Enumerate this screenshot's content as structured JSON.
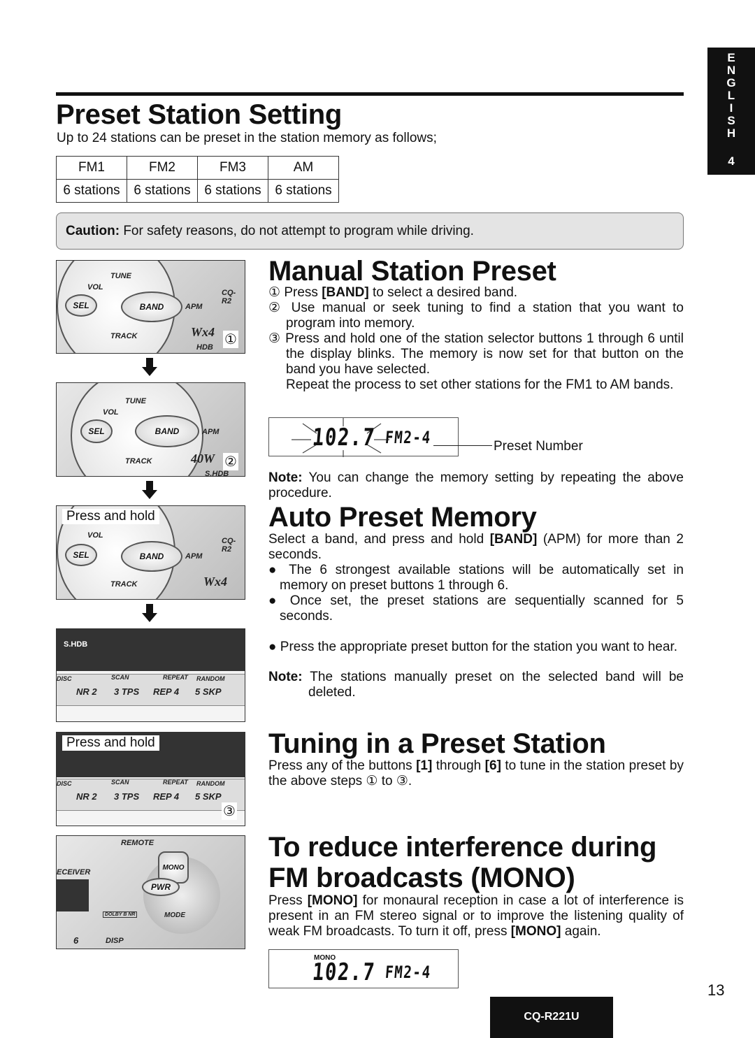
{
  "side_tab": {
    "letters": [
      "E",
      "N",
      "G",
      "L",
      "I",
      "S",
      "H"
    ],
    "number": "4"
  },
  "preset_setting": {
    "title": "Preset Station Setting",
    "intro": "Up to 24 stations can be preset in the station memory as follows;",
    "table": {
      "headers": [
        "FM1",
        "FM2",
        "FM3",
        "AM"
      ],
      "cells": [
        "6 stations",
        "6 stations",
        "6 stations",
        "6 stations"
      ]
    },
    "caution_label": "Caution:",
    "caution_text": " For safety reasons, do not attempt to program while driving."
  },
  "illustrations": {
    "panel1": {
      "labels": [
        "TUNE",
        "VOL",
        "SEL",
        "BAND",
        "APM",
        "TRACK",
        "CQ-R2",
        "Wx4",
        "HDB"
      ],
      "step": "①"
    },
    "panel2": {
      "labels": [
        "TUNE",
        "VOL",
        "SEL",
        "BAND",
        "APM",
        "TRACK",
        "40W",
        "S.HDB"
      ],
      "step": "②"
    },
    "panel3": {
      "press_hold": "Press and hold",
      "labels": [
        "VOL",
        "SEL",
        "BAND",
        "APM",
        "TRACK",
        "CQ-R2",
        "Wx4"
      ]
    },
    "panel4": {
      "labels": [
        "S.HDB",
        "DISC",
        "SCAN",
        "REPEAT",
        "RANDOM",
        "NR 2",
        "3 TPS",
        "REP 4",
        "5 SKP"
      ]
    },
    "panel5": {
      "press_hold": "Press and hold",
      "labels": [
        "DISC",
        "SCAN",
        "REPEAT",
        "RANDOM",
        "NR 2",
        "3 TPS",
        "REP 4",
        "5 SKP"
      ],
      "step": "③"
    },
    "panel6": {
      "labels": [
        "REMOTE",
        "MONO",
        "ECEIVER",
        "PWR",
        "DOLBY B NR",
        "MODE",
        "6",
        "DISP"
      ]
    }
  },
  "manual": {
    "title": "Manual Station Preset",
    "steps": [
      {
        "n": "①",
        "pre": "Press ",
        "b": "[BAND]",
        "post": " to select a desired band."
      },
      {
        "n": "②",
        "pre": "Use manual or seek tuning to find a station that you want to program into memory.",
        "b": "",
        "post": ""
      },
      {
        "n": "③",
        "pre": "Press and hold one of the station selector buttons 1 through 6 until the display blinks. The memory is now set for that button on the band you have selected.",
        "b": "",
        "post": ""
      }
    ],
    "repeat": "Repeat the process to set other stations for the FM1 to AM bands.",
    "display": {
      "freq": "102.7",
      "band": "FM2-4",
      "callout": "Preset Number"
    },
    "note_label": "Note:",
    "note": " You can change the memory setting by repeating the above procedure."
  },
  "auto": {
    "title": "Auto Preset Memory",
    "intro_pre": "Select a band, and press and hold ",
    "intro_b": "[BAND]",
    "intro_post": " (APM) for more than 2 seconds.",
    "bullets": [
      "The 6 strongest available stations will be automatically set in memory on preset buttons 1 through 6.",
      "Once set, the preset stations are sequentially scanned for 5 seconds.",
      "Press the appropriate preset button for the station you want to hear."
    ],
    "note_label": "Note:",
    "note": "The stations manually preset on the selected band will be deleted."
  },
  "tuning": {
    "title": "Tuning in a Preset Station",
    "p1": "Press any of the buttons ",
    "b1": "[1]",
    "p2": " through ",
    "b2": "[6]",
    "p3": " to tune in the station preset by the above steps ① to ③."
  },
  "mono": {
    "title1": "To reduce interference during",
    "title2": "FM broadcasts (MONO)",
    "p1": "Press ",
    "b1": "[MONO]",
    "p2": " for monaural reception in case a lot of interference is present in an FM stereo signal or to improve the listening quality of weak FM broadcasts.  To turn it off, press ",
    "b2": "[MONO]",
    "p3": " again.",
    "display": {
      "indicator": "MONO",
      "freq": "102.7",
      "band": "FM2-4"
    }
  },
  "page_number": "13",
  "model": "CQ-R221U"
}
